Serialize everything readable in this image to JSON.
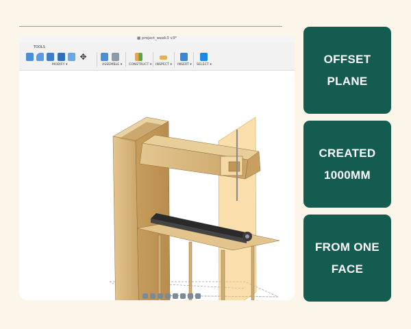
{
  "app": {
    "document_title": "project_week3 v3*",
    "tools_label": "TOOLS",
    "toolbar_groups": [
      "MODIFY ▾",
      "ASSEMBLE ▾",
      "CONSTRUCT ▾",
      "INSPECT ▾",
      "INSERT ▾",
      "SELECT ▾"
    ]
  },
  "icons": [
    "cube-icon",
    "fillet-icon",
    "press-pull-icon",
    "combine-icon",
    "move-icon",
    "assemble-icon",
    "joint-icon",
    "offset-plane-icon",
    "measure-icon",
    "insert-image-icon",
    "select-cursor-icon"
  ],
  "colors": {
    "page_background": "#fbf5ea",
    "card_background": "#145c50",
    "card_text": "#ffffff",
    "wood": "#d9b879",
    "plane_highlight": "#f6c46a",
    "selection_blue": "#1e88e5"
  },
  "cards": [
    {
      "text": "OFFSET PLANE"
    },
    {
      "text": "CREATED\n1000MM"
    },
    {
      "text": "FROM ONE\nFACE"
    }
  ]
}
